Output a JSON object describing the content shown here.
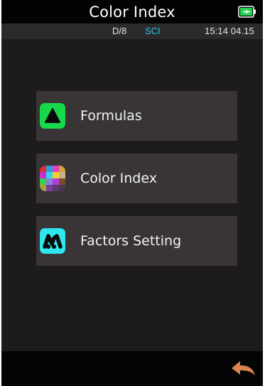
{
  "header": {
    "title": "Color Index",
    "battery_icon": "battery-charging-icon",
    "battery_color": "#1fd34a"
  },
  "status": {
    "mode": "D/8",
    "sci": "SCI",
    "time": "15:14 04.15",
    "sci_color": "#2fc7e8"
  },
  "menu": {
    "items": [
      {
        "label": "Formulas",
        "icon": "triangle-icon",
        "icon_color": "#18d84c"
      },
      {
        "label": "Color Index",
        "icon": "color-grid-icon",
        "icon_color": "multicolor"
      },
      {
        "label": "Factors Setting",
        "icon": "factors-icon",
        "icon_color": "#2ee6ee"
      }
    ]
  },
  "footer": {
    "back_icon": "back-arrow-icon",
    "back_color": "#d9844e"
  }
}
